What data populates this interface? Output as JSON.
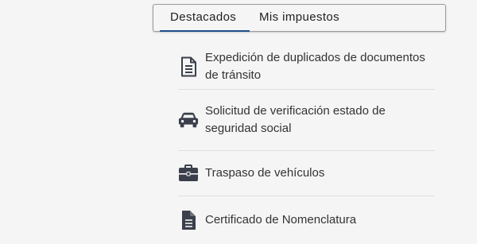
{
  "tabs": [
    {
      "label": "Destacados",
      "active": true
    },
    {
      "label": "Mis impuestos",
      "active": false
    }
  ],
  "items": [
    {
      "label": "Expedición de duplicados de documentos de tránsito",
      "icon": "document-icon"
    },
    {
      "label": "Solicitud de verificación estado de seguridad social",
      "icon": "car-icon"
    },
    {
      "label": "Traspaso de vehículos",
      "icon": "briefcase-icon"
    },
    {
      "label": "Certificado de Nomenclatura",
      "icon": "file-text-icon"
    }
  ],
  "colors": {
    "background": "#f5f5f5",
    "accent": "#1f4e8c",
    "icon": "#3a3f4b",
    "text": "#333333"
  }
}
